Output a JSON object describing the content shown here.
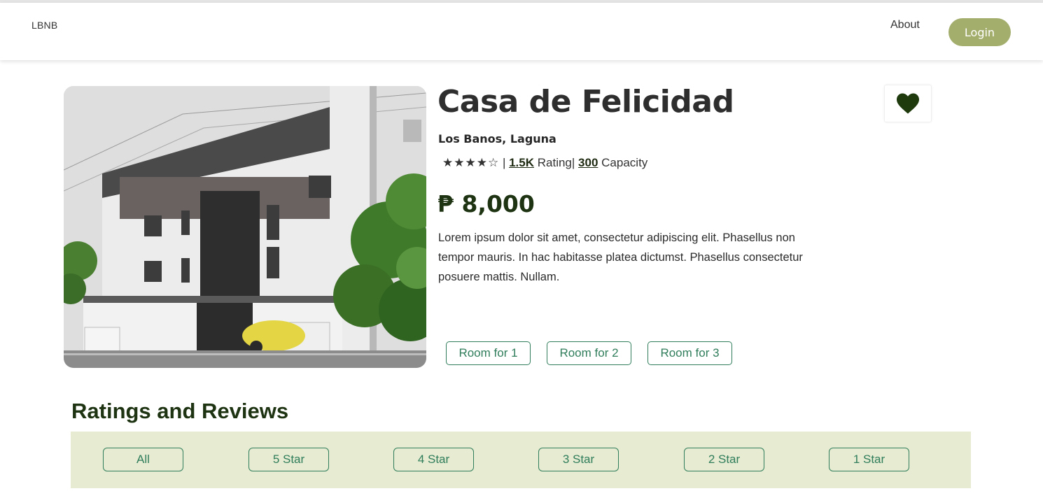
{
  "navbar": {
    "brand": "LBNB",
    "about_label": "About",
    "login_label": "Login"
  },
  "listing": {
    "photo_alt": "Photo of a multi-storey apartment building",
    "title": "Casa de Felicidad",
    "location": "Los Banos, Laguna",
    "stars_glyphs": "★★★★☆",
    "rating_value": 4,
    "rating_max": 5,
    "separator": "|",
    "rating_count": "1.5K",
    "rating_label": "Rating",
    "capacity_value": "300",
    "capacity_label": "Capacity",
    "price": "₱ 8,000",
    "description": "Lorem ipsum dolor sit amet, consectetur adipiscing elit. Phasellus non tempor mauris. In hac habitasse platea dictumst. Phasellus consectetur posuere mattis. Nullam.",
    "favorite_icon": "heart-icon",
    "rooms": [
      "Room for 1",
      "Room for 2",
      "Room for 3"
    ]
  },
  "reviews": {
    "title": "Ratings and Reviews",
    "filters": [
      "All",
      "5 Star",
      "4 Star",
      "3 Star",
      "2 Star",
      "1 Star"
    ]
  },
  "colors": {
    "accent_olive": "#a3ad6c",
    "dark_green": "#1d3311",
    "button_green": "#2f7d5b",
    "filter_bar_bg": "#e6ebd1",
    "heart": "#1f3a0d"
  }
}
